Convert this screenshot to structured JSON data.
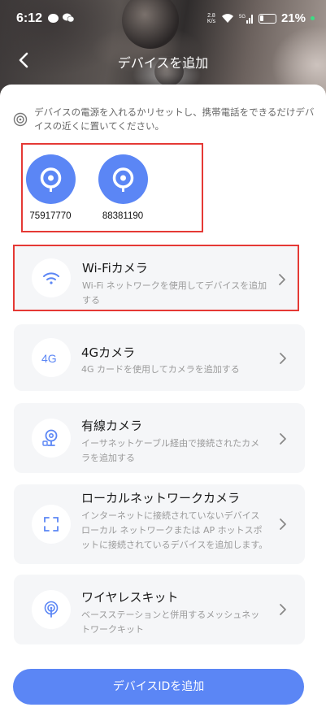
{
  "status_bar": {
    "time": "6:12",
    "net_speed_value": "2.8",
    "net_speed_unit": "K/s",
    "wifi_label": "",
    "signal_label": "5G",
    "battery_percent": "21%"
  },
  "header": {
    "title": "デバイスを追加"
  },
  "tip": {
    "text": "デバイスの電源を入れるかリセットし、携帯電話をできるだけデバイスの近くに置いてください。"
  },
  "found_devices": [
    {
      "id": "75917770"
    },
    {
      "id": "88381190"
    }
  ],
  "options": [
    {
      "title": "Wi-Fiカメラ",
      "description": "Wi-Fi ネットワークを使用してデバイスを追加する",
      "icon": "wifi-icon"
    },
    {
      "title": "4Gカメラ",
      "description": "4G カードを使用してカメラを追加する",
      "icon": "4g-icon"
    },
    {
      "title": "有線カメラ",
      "description": "イーサネットケーブル経由で接続されたカメラを追加する",
      "icon": "wired-camera-icon"
    },
    {
      "title": "ローカルネットワークカメラ",
      "description": "インターネットに接続されていないデバイスローカル ネットワークまたは AP ホットスポットに接続されているデバイスを追加します。",
      "icon": "scan-frame-icon"
    },
    {
      "title": "ワイヤレスキット",
      "description": "ベースステーションと併用するメッシュネットワークキット",
      "icon": "wireless-kit-icon"
    }
  ],
  "add_button": {
    "label": "デバイスIDを追加"
  },
  "colors": {
    "accent": "#5b86f5",
    "highlight_border": "#e53935",
    "card_bg": "#f5f6f8"
  }
}
